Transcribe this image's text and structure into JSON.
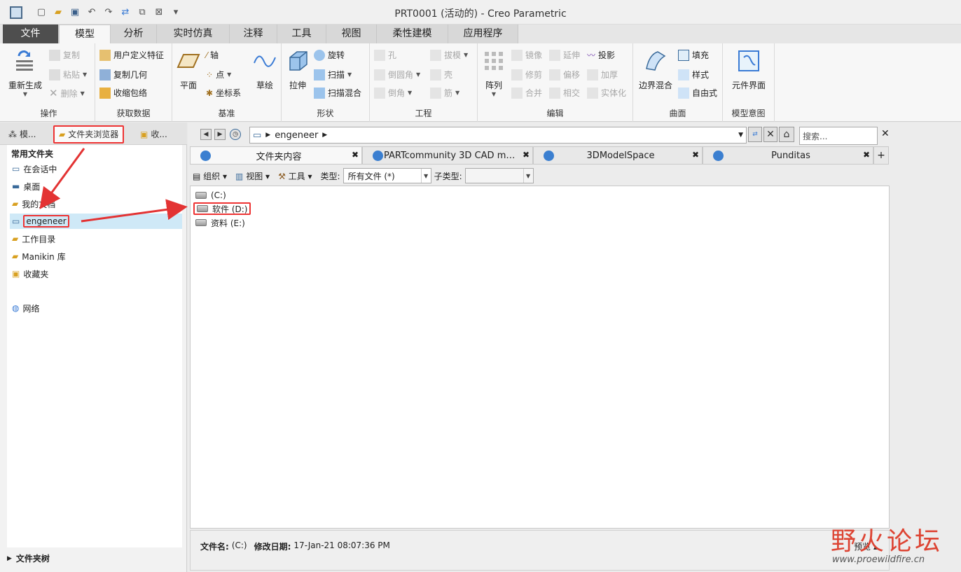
{
  "window": {
    "title": "PRT0001 (活动的) - Creo Parametric"
  },
  "ribbon_tabs": [
    "文件",
    "模型",
    "分析",
    "实时仿真",
    "注释",
    "工具",
    "视图",
    "柔性建模",
    "应用程序"
  ],
  "ribbon": {
    "ops": {
      "label": "操作",
      "regen": "重新生成",
      "copy": "复制",
      "paste": "粘贴",
      "delete": "删除"
    },
    "getdata": {
      "label": "获取数据",
      "udf": "用户定义特征",
      "copygeom": "复制几何",
      "shrinkwrap": "收缩包络"
    },
    "datum": {
      "label": "基准",
      "plane": "平面",
      "axis": "轴",
      "point": "点",
      "csys": "坐标系",
      "sketch": "草绘"
    },
    "shapes": {
      "label": "形状",
      "extrude": "拉伸",
      "revolve": "旋转",
      "sweep": "扫描",
      "sweptblend": "扫描混合"
    },
    "eng": {
      "label": "工程",
      "hole": "孔",
      "round": "倒圆角",
      "chamfer": "倒角",
      "draft": "拔模",
      "shell": "壳",
      "rib": "筋"
    },
    "edit": {
      "label": "编辑",
      "pattern": "阵列",
      "mirror": "镜像",
      "trim": "修剪",
      "merge": "合并",
      "extend": "延伸",
      "offset": "偏移",
      "intersect": "相交",
      "project": "投影",
      "thicken": "加厚",
      "solidify": "实体化"
    },
    "surfaces": {
      "label": "曲面",
      "boundary": "边界混合",
      "fill": "填充",
      "style": "样式",
      "freestyle": "自由式"
    },
    "intent": {
      "label": "模型意图",
      "component_interface": "元件界面"
    }
  },
  "left_panel": {
    "tabs": [
      "模...",
      "文件夹浏览器",
      "收..."
    ],
    "header": "常用文件夹",
    "items": [
      "在会话中",
      "桌面",
      "我的文档",
      "engeneer",
      "工作目录",
      "Manikin 库",
      "收藏夹",
      "网络"
    ],
    "footer": "文件夹树"
  },
  "browser": {
    "address": "engeneer",
    "search_placeholder": "搜索...",
    "tabs": [
      "文件夹内容",
      "PARTcommunity 3D CAD man...",
      "3DModelSpace",
      "Punditas"
    ],
    "toolbar": {
      "organize": "组织",
      "view": "视图",
      "tools": "工具",
      "type_label": "类型:",
      "type_value": "所有文件 (*)",
      "subtype_label": "子类型:"
    },
    "files": [
      "(C:)",
      "软件 (D:)",
      "资料 (E:)"
    ],
    "status": {
      "filename_label": "文件名:",
      "filename": "(C:)",
      "modified_label": "修改日期:",
      "modified": "17-Jan-21 08:07:36 PM",
      "preview": "预览"
    }
  },
  "watermark": {
    "cn": "野火论坛",
    "url": "www.proewildfire.cn"
  },
  "colors": {
    "highlight": "#e33333",
    "selection": "#cfe9f7",
    "file_tab": "#4e4e4e"
  }
}
